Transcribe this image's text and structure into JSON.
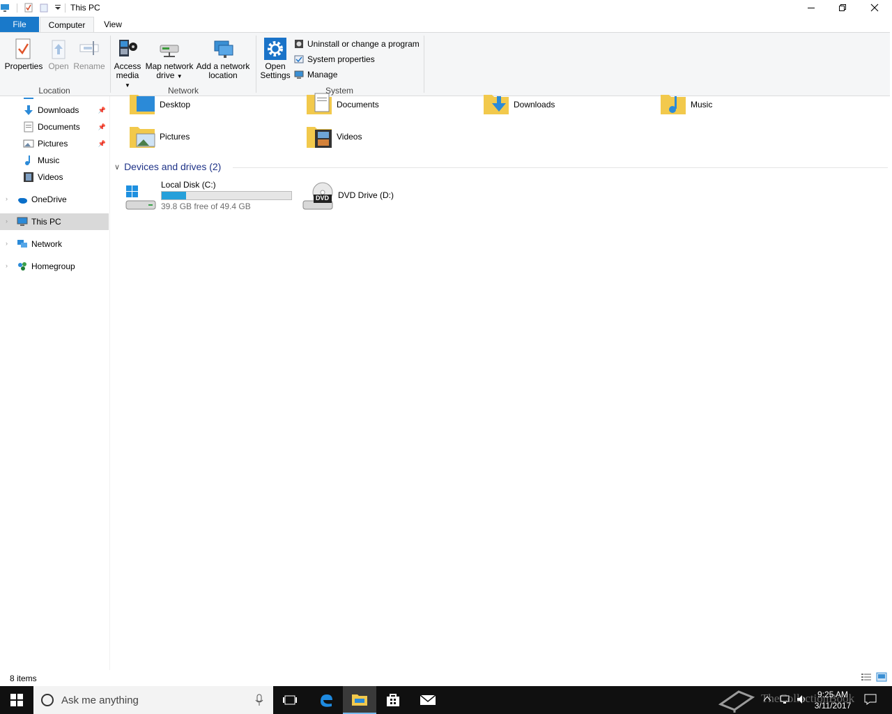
{
  "window": {
    "title": "This PC"
  },
  "tabs": {
    "file": "File",
    "computer": "Computer",
    "view": "View"
  },
  "ribbon": {
    "location": {
      "label": "Location",
      "properties": "Properties",
      "open": "Open",
      "rename": "Rename"
    },
    "network": {
      "label": "Network",
      "access_media_1": "Access",
      "access_media_2": "media",
      "map_drive_1": "Map network",
      "map_drive_2": "drive",
      "add_location_1": "Add a network",
      "add_location_2": "location"
    },
    "system": {
      "label": "System",
      "open_settings_1": "Open",
      "open_settings_2": "Settings",
      "uninstall": "Uninstall or change a program",
      "system_properties": "System properties",
      "manage": "Manage"
    },
    "help": "?"
  },
  "nav": {
    "items": [
      {
        "label": "Downloads",
        "pinned": true
      },
      {
        "label": "Documents",
        "pinned": true
      },
      {
        "label": "Pictures",
        "pinned": true
      },
      {
        "label": "Music"
      },
      {
        "label": "Videos"
      },
      {
        "label": "OneDrive"
      },
      {
        "label": "This PC",
        "selected": true
      },
      {
        "label": "Network"
      },
      {
        "label": "Homegroup"
      }
    ]
  },
  "folders": [
    {
      "label": "Desktop"
    },
    {
      "label": "Documents"
    },
    {
      "label": "Downloads"
    },
    {
      "label": "Music"
    },
    {
      "label": "Pictures"
    },
    {
      "label": "Videos"
    }
  ],
  "devices": {
    "header": "Devices and drives (2)",
    "drives": [
      {
        "label": "Local Disk (C:)",
        "free": "39.8 GB free of 49.4 GB",
        "used_fraction": 0.19
      },
      {
        "label": "DVD Drive (D:)",
        "badge": "DVD"
      }
    ]
  },
  "status": {
    "items": "8 items"
  },
  "taskbar": {
    "search_placeholder": "Ask me anything",
    "time": "9:25 AM",
    "date": "3/11/2017",
    "watermark": "TheCollectionBook"
  },
  "colors": {
    "accent": "#1979ca",
    "header_blue": "#1e3287",
    "selected_bg": "#d9d9d9"
  }
}
